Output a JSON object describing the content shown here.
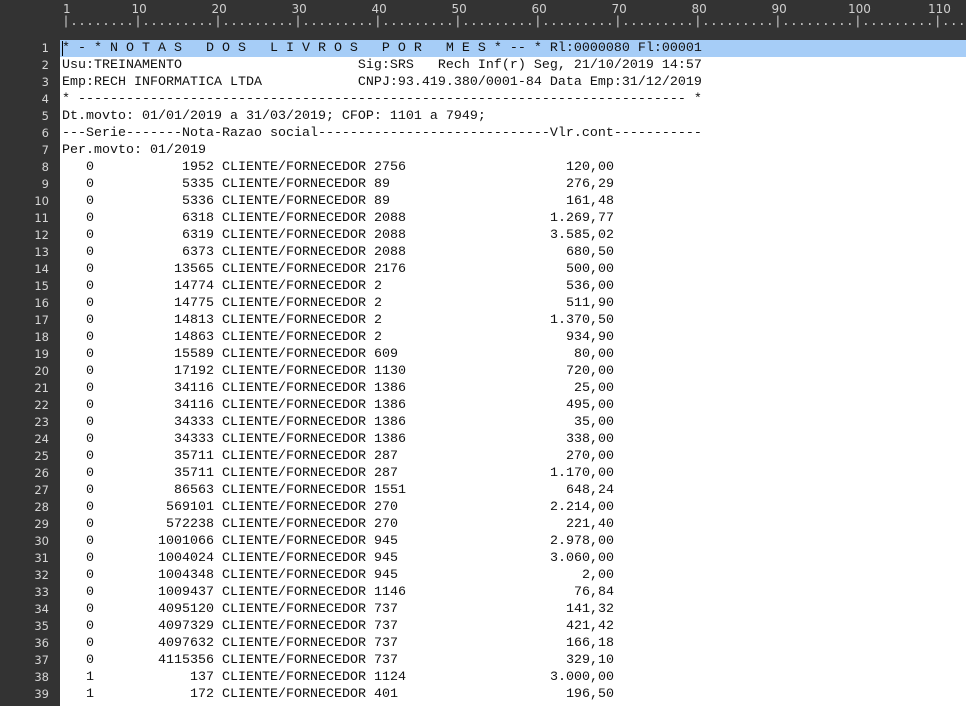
{
  "ruler": {
    "labels": [
      "1",
      "10",
      "20",
      "30",
      "40",
      "50",
      "60",
      "70",
      "80",
      "90",
      "100",
      "110"
    ]
  },
  "header_lines": [
    "* - * N O T A S   D O S   L I V R O S   P O R   M E S * -- * Rl:0000080 Fl:00001",
    "Usu:TREINAMENTO                      Sig:SRS   Rech Inf(r) Seg, 21/10/2019 14:57",
    "Emp:RECH INFORMATICA LTDA            CNPJ:93.419.380/0001-84 Data Emp:31/12/2019",
    "* ---------------------------------------------------------------------------- *",
    "Dt.movto: 01/01/2019 a 31/03/2019; CFOP: 1101 a 7949;",
    "---Serie-------Nota-Razao social-----------------------------Vlr.cont-----------",
    "Per.movto: 01/2019"
  ],
  "rows": [
    {
      "serie": "0",
      "nota": "1952",
      "razao": "CLIENTE/FORNECEDOR 2756",
      "valor": "120,00"
    },
    {
      "serie": "0",
      "nota": "5335",
      "razao": "CLIENTE/FORNECEDOR 89",
      "valor": "276,29"
    },
    {
      "serie": "0",
      "nota": "5336",
      "razao": "CLIENTE/FORNECEDOR 89",
      "valor": "161,48"
    },
    {
      "serie": "0",
      "nota": "6318",
      "razao": "CLIENTE/FORNECEDOR 2088",
      "valor": "1.269,77"
    },
    {
      "serie": "0",
      "nota": "6319",
      "razao": "CLIENTE/FORNECEDOR 2088",
      "valor": "3.585,02"
    },
    {
      "serie": "0",
      "nota": "6373",
      "razao": "CLIENTE/FORNECEDOR 2088",
      "valor": "680,50"
    },
    {
      "serie": "0",
      "nota": "13565",
      "razao": "CLIENTE/FORNECEDOR 2176",
      "valor": "500,00"
    },
    {
      "serie": "0",
      "nota": "14774",
      "razao": "CLIENTE/FORNECEDOR 2",
      "valor": "536,00"
    },
    {
      "serie": "0",
      "nota": "14775",
      "razao": "CLIENTE/FORNECEDOR 2",
      "valor": "511,90"
    },
    {
      "serie": "0",
      "nota": "14813",
      "razao": "CLIENTE/FORNECEDOR 2",
      "valor": "1.370,50"
    },
    {
      "serie": "0",
      "nota": "14863",
      "razao": "CLIENTE/FORNECEDOR 2",
      "valor": "934,90"
    },
    {
      "serie": "0",
      "nota": "15589",
      "razao": "CLIENTE/FORNECEDOR 609",
      "valor": "80,00"
    },
    {
      "serie": "0",
      "nota": "17192",
      "razao": "CLIENTE/FORNECEDOR 1130",
      "valor": "720,00"
    },
    {
      "serie": "0",
      "nota": "34116",
      "razao": "CLIENTE/FORNECEDOR 1386",
      "valor": "25,00"
    },
    {
      "serie": "0",
      "nota": "34116",
      "razao": "CLIENTE/FORNECEDOR 1386",
      "valor": "495,00"
    },
    {
      "serie": "0",
      "nota": "34333",
      "razao": "CLIENTE/FORNECEDOR 1386",
      "valor": "35,00"
    },
    {
      "serie": "0",
      "nota": "34333",
      "razao": "CLIENTE/FORNECEDOR 1386",
      "valor": "338,00"
    },
    {
      "serie": "0",
      "nota": "35711",
      "razao": "CLIENTE/FORNECEDOR 287",
      "valor": "270,00"
    },
    {
      "serie": "0",
      "nota": "35711",
      "razao": "CLIENTE/FORNECEDOR 287",
      "valor": "1.170,00"
    },
    {
      "serie": "0",
      "nota": "86563",
      "razao": "CLIENTE/FORNECEDOR 1551",
      "valor": "648,24"
    },
    {
      "serie": "0",
      "nota": "569101",
      "razao": "CLIENTE/FORNECEDOR 270",
      "valor": "2.214,00"
    },
    {
      "serie": "0",
      "nota": "572238",
      "razao": "CLIENTE/FORNECEDOR 270",
      "valor": "221,40"
    },
    {
      "serie": "0",
      "nota": "1001066",
      "razao": "CLIENTE/FORNECEDOR 945",
      "valor": "2.978,00"
    },
    {
      "serie": "0",
      "nota": "1004024",
      "razao": "CLIENTE/FORNECEDOR 945",
      "valor": "3.060,00"
    },
    {
      "serie": "0",
      "nota": "1004348",
      "razao": "CLIENTE/FORNECEDOR 945",
      "valor": "2,00"
    },
    {
      "serie": "0",
      "nota": "1009437",
      "razao": "CLIENTE/FORNECEDOR 1146",
      "valor": "76,84"
    },
    {
      "serie": "0",
      "nota": "4095120",
      "razao": "CLIENTE/FORNECEDOR 737",
      "valor": "141,32"
    },
    {
      "serie": "0",
      "nota": "4097329",
      "razao": "CLIENTE/FORNECEDOR 737",
      "valor": "421,42"
    },
    {
      "serie": "0",
      "nota": "4097632",
      "razao": "CLIENTE/FORNECEDOR 737",
      "valor": "166,18"
    },
    {
      "serie": "0",
      "nota": "4115356",
      "razao": "CLIENTE/FORNECEDOR 737",
      "valor": "329,10"
    },
    {
      "serie": "1",
      "nota": "137",
      "razao": "CLIENTE/FORNECEDOR 1124",
      "valor": "3.000,00"
    },
    {
      "serie": "1",
      "nota": "172",
      "razao": "CLIENTE/FORNECEDOR 401",
      "valor": "196,50"
    }
  ],
  "line_numbers": [
    "1",
    "2",
    "3",
    "4",
    "5",
    "6",
    "7",
    "8",
    "9",
    "10",
    "11",
    "12",
    "13",
    "14",
    "15",
    "16",
    "17",
    "18",
    "19",
    "20",
    "21",
    "22",
    "23",
    "24",
    "25",
    "26",
    "27",
    "28",
    "29",
    "30",
    "31",
    "32",
    "33",
    "34",
    "35",
    "36",
    "37",
    "38",
    "39"
  ],
  "colors": {
    "current_line": "#a6cdf7",
    "chrome": "#333333"
  }
}
